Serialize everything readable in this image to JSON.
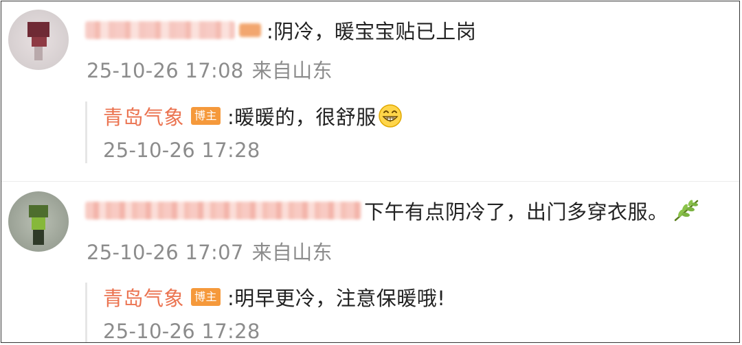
{
  "comments": [
    {
      "avatar_icon": "blurred-user-avatar",
      "username_blurred": true,
      "text": ":阴冷，暖宝宝贴已上岗",
      "timestamp": "25-10-26 17:08",
      "location": "来自山东",
      "reply": {
        "author": "青岛气象",
        "badge": "博主",
        "text": ":暖暖的，很舒服",
        "emoji_icon": "grin-emoji-icon",
        "timestamp": "25-10-26 17:28"
      }
    },
    {
      "avatar_icon": "blurred-user-avatar",
      "username_blurred": true,
      "text": "下午有点阴冷了，出门多穿衣服。",
      "emoji_icon": "leaf-emoji-icon",
      "timestamp": "25-10-26 17:07",
      "location": "来自山东",
      "reply": {
        "author": "青岛气象",
        "badge": "博主",
        "text": ":明早更冷，注意保暖哦!",
        "timestamp": "25-10-26 17:28"
      }
    }
  ],
  "colors": {
    "author_accent": "#eb7350",
    "badge_bg": "#f5993b",
    "meta_text": "#8c8c8c",
    "body_text": "#222222"
  }
}
